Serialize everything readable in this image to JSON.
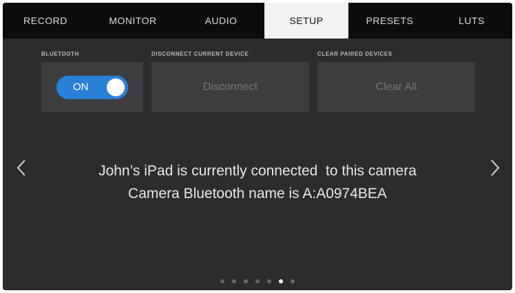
{
  "tabs": [
    {
      "label": "RECORD",
      "active": false
    },
    {
      "label": "MONITOR",
      "active": false
    },
    {
      "label": "AUDIO",
      "active": false
    },
    {
      "label": "SETUP",
      "active": true
    },
    {
      "label": "PRESETS",
      "active": false
    },
    {
      "label": "LUTS",
      "active": false
    }
  ],
  "bluetooth": {
    "label": "BLUETOOTH",
    "toggle_text": "ON",
    "enabled": true
  },
  "disconnect": {
    "label": "DISCONNECT CURRENT DEVICE",
    "button_label": "Disconnect"
  },
  "clear_paired": {
    "label": "CLEAR PAIRED DEVICES",
    "button_label": "Clear All"
  },
  "message": {
    "line1": "John’s iPad is currently connected  to this camera",
    "line2": "Camera Bluetooth name is A:A0974BEA"
  },
  "pagination": {
    "total": 7,
    "current": 6
  },
  "colors": {
    "accent": "#2a7fd8",
    "tab_active_bg": "#f2f2f2",
    "screen_bg": "#2c2c2e",
    "tabbar_bg": "#0c0c0c"
  },
  "icons": {
    "prev": "chevron-left-icon",
    "next": "chevron-right-icon"
  }
}
